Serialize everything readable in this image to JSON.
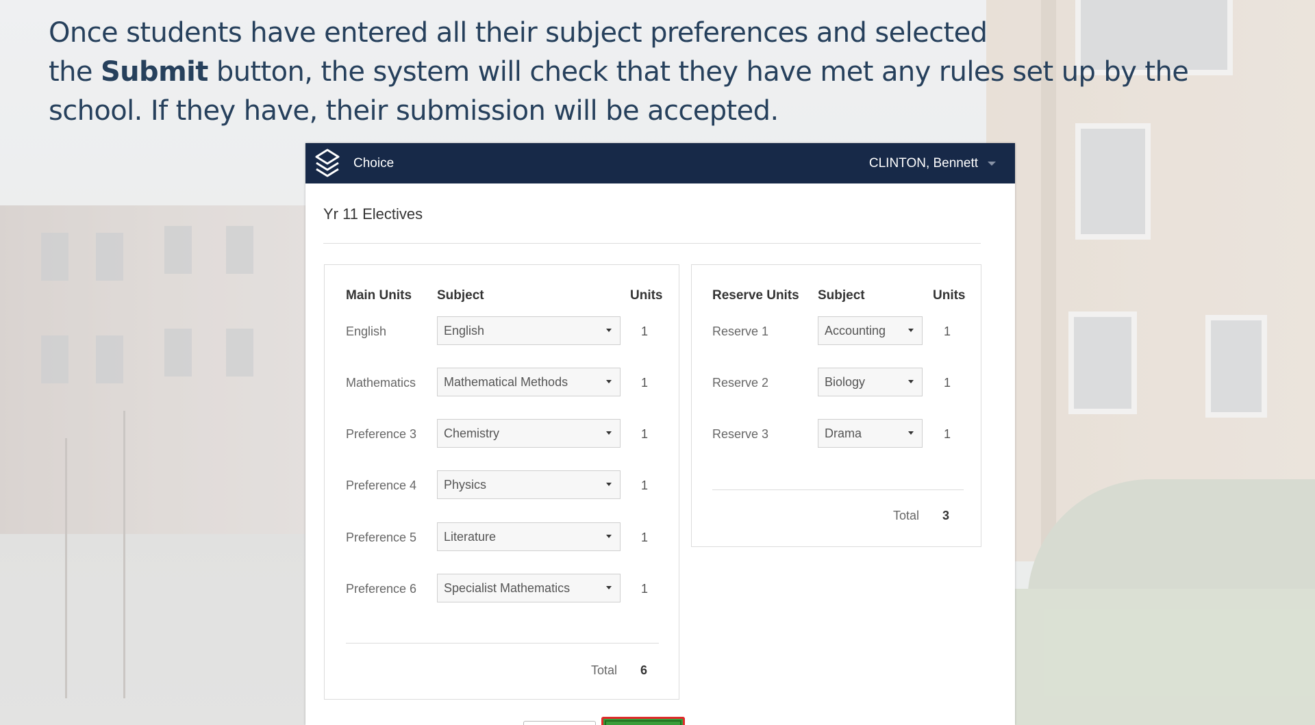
{
  "caption": {
    "line1": "Once students have entered all their subject preferences and selected",
    "line2_pre": "the ",
    "line2_bold": "Submit",
    "line2_post": " button, the system will check that they have met any rules set up by the",
    "line3": "school. If they have, their submission will be accepted."
  },
  "app": {
    "name": "Choice",
    "logo_icon": "layers-icon",
    "user_name": "CLINTON, Bennett",
    "page_title": "Yr 11 Electives"
  },
  "main": {
    "headers": {
      "label": "Main Units",
      "subject": "Subject",
      "units": "Units"
    },
    "rows": [
      {
        "label": "English",
        "subject": "English",
        "units": "1"
      },
      {
        "label": "Mathematics",
        "subject": "Mathematical Methods",
        "units": "1"
      },
      {
        "label": "Preference 3",
        "subject": "Chemistry",
        "units": "1"
      },
      {
        "label": "Preference 4",
        "subject": "Physics",
        "units": "1"
      },
      {
        "label": "Preference 5",
        "subject": "Literature",
        "units": "1"
      },
      {
        "label": "Preference 6",
        "subject": "Specialist Mathematics",
        "units": "1"
      }
    ],
    "total_label": "Total",
    "total_value": "6"
  },
  "reserve": {
    "headers": {
      "label": "Reserve Units",
      "subject": "Subject",
      "units": "Units"
    },
    "rows": [
      {
        "label": "Reserve 1",
        "subject": "Accounting",
        "units": "1"
      },
      {
        "label": "Reserve 2",
        "subject": "Biology",
        "units": "1"
      },
      {
        "label": "Reserve 3",
        "subject": "Drama",
        "units": "1"
      }
    ],
    "total_label": "Total",
    "total_value": "3"
  },
  "colors": {
    "caption_text": "#26405c",
    "topbar": "#172948",
    "submit_highlight": "#e02b2b",
    "submit_fill": "#3a9d3a"
  }
}
